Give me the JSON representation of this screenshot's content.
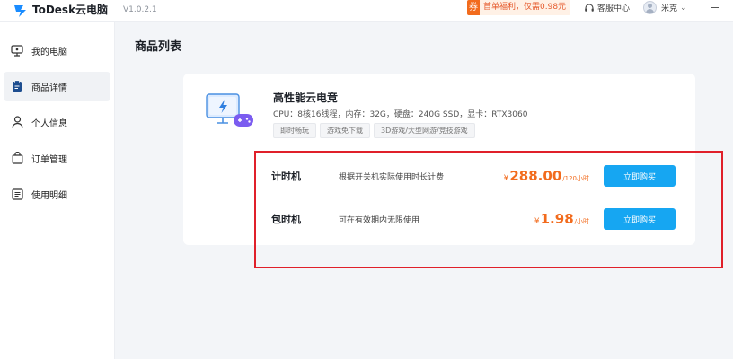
{
  "titlebar": {
    "app_name": "ToDesk云电脑",
    "version": "V1.0.2.1",
    "promo_badge": "券",
    "promo_text": "首单福利，仅需0.98元",
    "service_label": "客服中心",
    "user_name": "米克"
  },
  "sidebar": {
    "items": [
      {
        "label": "我的电脑",
        "icon": "monitor-icon",
        "active": false
      },
      {
        "label": "商品详情",
        "icon": "clipboard-icon",
        "active": true
      },
      {
        "label": "个人信息",
        "icon": "person-icon",
        "active": false
      },
      {
        "label": "订单管理",
        "icon": "shopping-bag-icon",
        "active": false
      },
      {
        "label": "使用明细",
        "icon": "list-icon",
        "active": false
      }
    ]
  },
  "main": {
    "title": "商品列表",
    "product": {
      "name": "高性能云电竞",
      "specs": "CPU：8核16线程，内存：32G，硬盘：240G SSD，显卡：RTX3060",
      "tags": [
        "即时畅玩",
        "游戏免下载",
        "3D游戏/大型网游/竞技游戏"
      ],
      "plans": [
        {
          "name": "计时机",
          "desc": "根据开关机实际使用时长计费",
          "currency": "¥",
          "price": "288.00",
          "unit": "/120小时",
          "button": "立即购买"
        },
        {
          "name": "包时机",
          "desc": "可在有效期内无限使用",
          "currency": "¥",
          "price": "1.98",
          "unit": "/小时",
          "button": "立即购买"
        }
      ]
    }
  },
  "colors": {
    "accent": "#16a6f2",
    "price": "#f26b1d",
    "highlight": "#e0202a"
  }
}
